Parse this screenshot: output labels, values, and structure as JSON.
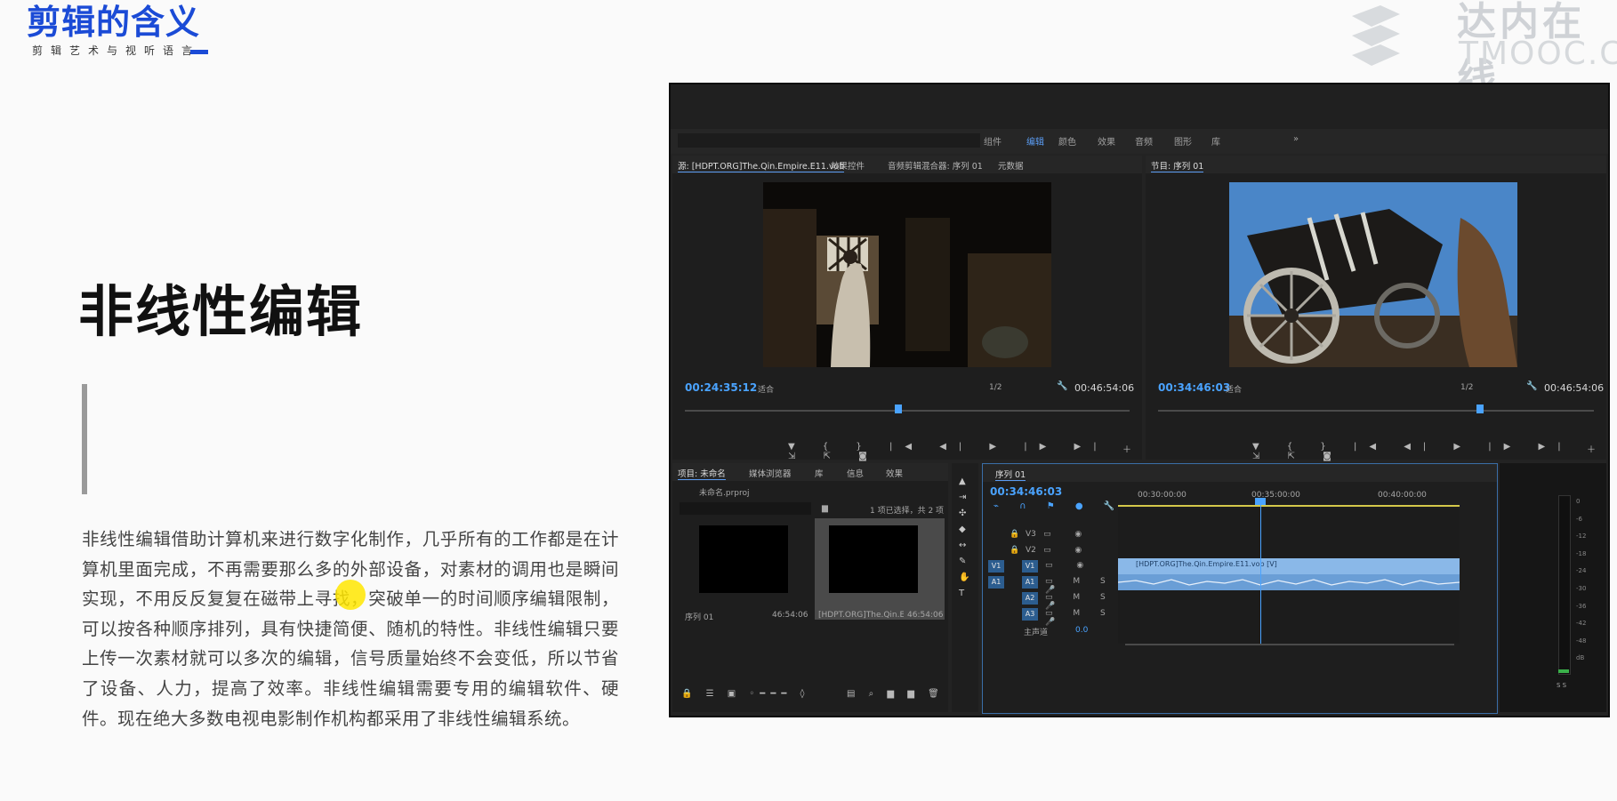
{
  "slide": {
    "brand_title": "剪辑的含义",
    "brand_subtitle": "剪辑艺术与视听语言",
    "watermark_line1": "达内在线",
    "watermark_line2": "TMOOC.CN",
    "heading": "非线性编辑",
    "paragraph": "非线性编辑借助计算机来进行数字化制作，几乎所有的工作都是在计算机里面完成，不再需要那么多的外部设备，对素材的调用也是瞬间实现，不用反反复复在磁带上寻找，突破单一的时间顺序编辑限制，可以按各种顺序排列，具有快捷简便、随机的特性。非线性编辑只要上传一次素材就可以多次的编辑，信号质量始终不会变低，所以节省了设备、人力，提高了效率。非线性编辑需要专用的编辑软件、硬件。现在绝大多数电视电影制作机构都采用了非线性编辑系统。"
  },
  "colors": {
    "brand_blue": "#1b4bd6",
    "timecode_blue": "#4aa3ff",
    "clip_video": "#8ab8e8",
    "clip_audio": "#6a9ed6"
  },
  "premiere": {
    "workspaces": [
      {
        "label": "组件",
        "active": false
      },
      {
        "label": "编辑",
        "active": true
      },
      {
        "label": "颜色",
        "active": false
      },
      {
        "label": "效果",
        "active": false
      },
      {
        "label": "音频",
        "active": false
      },
      {
        "label": "图形",
        "active": false
      },
      {
        "label": "库",
        "active": false
      }
    ],
    "workspace_more": "»",
    "source": {
      "tabs": [
        "源: [HDPT.ORG]The.Qin.Empire.E11.vob",
        "效果控件",
        "音频剪辑混合器: 序列 01",
        "元数据"
      ],
      "timecode": "00:24:35:12",
      "fit": "适合",
      "resolution": "1/2",
      "duration": "00:46:54:06"
    },
    "program": {
      "tab": "节目: 序列 01",
      "timecode": "00:34:46:03",
      "fit": "适合",
      "resolution": "1/2",
      "duration": "00:46:54:06"
    },
    "project": {
      "tabs": [
        "项目: 未命名",
        "媒体浏览器",
        "库",
        "信息",
        "效果"
      ],
      "file": "未命名.prproj",
      "selection_info": "1 项已选择，共 2 项",
      "items": [
        {
          "name": "序列 01",
          "duration": "46:54:06"
        },
        {
          "name": "[HDPT.ORG]The.Qin.Empi...",
          "duration": "46:54:06"
        }
      ]
    },
    "timeline": {
      "tab": "序列 01",
      "timecode": "00:34:46:03",
      "ruler": [
        "00:30:00:00",
        "00:35:00:00",
        "00:40:00:00"
      ],
      "video_tracks": [
        "V3",
        "V2",
        "V1"
      ],
      "audio_tracks": [
        "A1",
        "A2",
        "A3"
      ],
      "master_label": "主声道",
      "master_value": "0.0",
      "clip_label": "[HDPT.ORG]The.Qin.Empire.E11.vob [V]"
    },
    "meter_scale": [
      "0",
      "-6",
      "-12",
      "-18",
      "-24",
      "-30",
      "-36",
      "-42",
      "-48",
      "dB"
    ],
    "meter_foot": "S S"
  }
}
